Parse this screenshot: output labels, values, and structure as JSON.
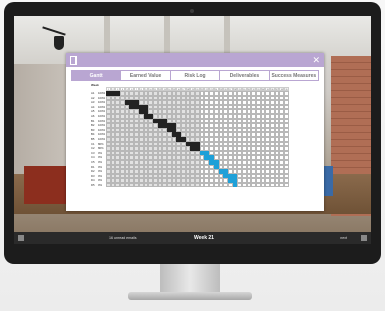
{
  "app": {
    "tabs": [
      {
        "label": "Gantt",
        "active": true
      },
      {
        "label": "Earned Value",
        "active": false
      },
      {
        "label": "Risk Log",
        "active": false
      },
      {
        "label": "Deliverables",
        "active": false
      },
      {
        "label": "Success Measures",
        "active": false
      }
    ],
    "gantt": {
      "week_header": "Week",
      "num_weeks": 39,
      "current_week": 21,
      "rows": [
        {
          "id": "A1",
          "pct": "100%",
          "start": 1,
          "len": 3,
          "color": "dark"
        },
        {
          "id": "A2",
          "pct": "100%",
          "start": 1,
          "len": 0,
          "color": "dark"
        },
        {
          "id": "A3",
          "pct": "100%",
          "start": 5,
          "len": 3,
          "color": "dark"
        },
        {
          "id": "A4",
          "pct": "100%",
          "start": 6,
          "len": 4,
          "color": "dark"
        },
        {
          "id": "A5",
          "pct": "100%",
          "start": 8,
          "len": 2,
          "color": "dark"
        },
        {
          "id": "A6",
          "pct": "100%",
          "start": 9,
          "len": 2,
          "color": "dark"
        },
        {
          "id": "B1",
          "pct": "100%",
          "start": 11,
          "len": 3,
          "color": "dark"
        },
        {
          "id": "B2",
          "pct": "100%",
          "start": 12,
          "len": 4,
          "color": "dark"
        },
        {
          "id": "B3",
          "pct": "100%",
          "start": 14,
          "len": 2,
          "color": "dark"
        },
        {
          "id": "B4",
          "pct": "100%",
          "start": 15,
          "len": 2,
          "color": "dark"
        },
        {
          "id": "B5",
          "pct": "100%",
          "start": 16,
          "len": 2,
          "color": "dark"
        },
        {
          "id": "C1",
          "pct": "80%",
          "start": 18,
          "len": 3,
          "color": "dark"
        },
        {
          "id": "C2",
          "pct": "80%",
          "start": 19,
          "len": 2,
          "color": "dark"
        },
        {
          "id": "C3",
          "pct": "0%",
          "start": 21,
          "len": 2,
          "color": "blue"
        },
        {
          "id": "C4",
          "pct": "0%",
          "start": 22,
          "len": 2,
          "color": "blue"
        },
        {
          "id": "C5",
          "pct": "0%",
          "start": 23,
          "len": 2,
          "color": "blue"
        },
        {
          "id": "D1",
          "pct": "0%",
          "start": 24,
          "len": 1,
          "color": "blue"
        },
        {
          "id": "D2",
          "pct": "0%",
          "start": 25,
          "len": 2,
          "color": "blue"
        },
        {
          "id": "D3",
          "pct": "0%",
          "start": 26,
          "len": 3,
          "color": "blue"
        },
        {
          "id": "D4",
          "pct": "0%",
          "start": 27,
          "len": 2,
          "color": "blue"
        },
        {
          "id": "D5",
          "pct": "0%",
          "start": 28,
          "len": 1,
          "color": "blue"
        }
      ]
    }
  },
  "taskbar": {
    "left_text": "16 unread emails",
    "week_label": "Week 21",
    "right_text": "next"
  }
}
